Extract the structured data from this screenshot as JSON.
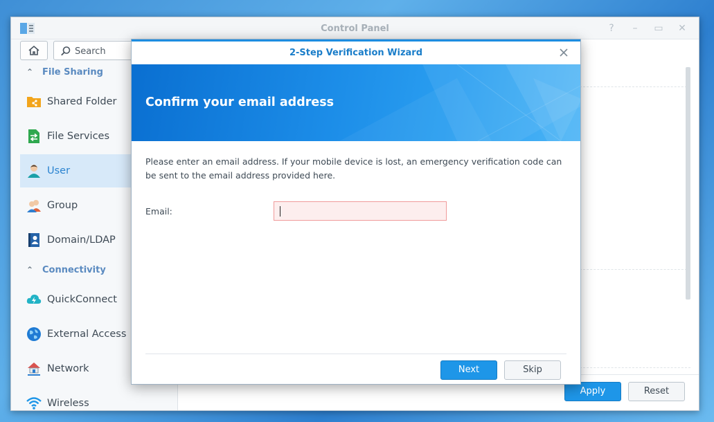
{
  "window": {
    "title": "Control Panel"
  },
  "window_controls": [
    "?",
    "–",
    "▭",
    "✕"
  ],
  "sidebar": {
    "search": {
      "placeholder": "Search"
    },
    "sections": [
      {
        "label": "File Sharing"
      },
      {
        "label": "Connectivity"
      }
    ],
    "items": [
      {
        "label": "Shared Folder",
        "icon": "shared-folder-icon"
      },
      {
        "label": "File Services",
        "icon": "file-services-icon"
      },
      {
        "label": "User",
        "icon": "user-icon",
        "active": true
      },
      {
        "label": "Group",
        "icon": "group-icon"
      },
      {
        "label": "Domain/LDAP",
        "icon": "domain-ldap-icon"
      },
      {
        "label": "QuickConnect",
        "icon": "quickconnect-icon"
      },
      {
        "label": "External Access",
        "icon": "external-access-icon"
      },
      {
        "label": "Network",
        "icon": "network-icon"
      },
      {
        "label": "Wireless",
        "icon": "wireless-icon"
      }
    ]
  },
  "main": {
    "apply_label": "Apply",
    "reset_label": "Reset"
  },
  "dialog": {
    "title": "2-Step Verification Wizard",
    "heading": "Confirm your email address",
    "description": "Please enter an email address. If your mobile device is lost, an emergency verification code can be sent to the email address provided here.",
    "email_label": "Email:",
    "email_value": "",
    "next_label": "Next",
    "skip_label": "Skip"
  },
  "colors": {
    "accent": "#1e96e8",
    "banner": "#1c8de8",
    "active_item": "#d7e9f9",
    "error_field": "#fdeeee"
  }
}
